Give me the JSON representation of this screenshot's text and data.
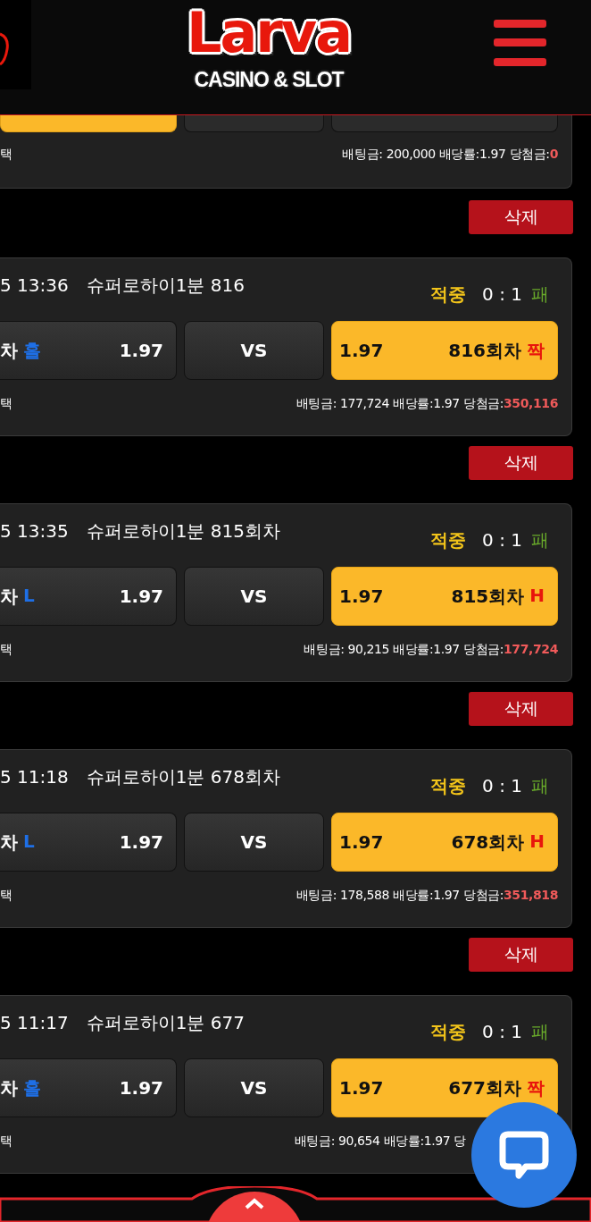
{
  "header": {
    "logo": {
      "title": "Larva",
      "subtitle": "CASINO & SLOT"
    }
  },
  "top_card": {
    "buttons": [
      {
        "selected": true
      },
      {
        "selected": false
      },
      {
        "selected": false
      }
    ],
    "choice": "택",
    "bet": "배팅금: 200,000 배당률:1.97 당첨금:",
    "win": "0",
    "delete": "삭제"
  },
  "cards": [
    {
      "date": "5 13:36",
      "game": "슈퍼로하이1분 816",
      "result": "적중",
      "score": "0 : 1",
      "outcome": "패",
      "left": {
        "label": "차",
        "pick": "홀",
        "color": "#1e6fe6",
        "odds": "1.97",
        "selected": false
      },
      "vs": "VS",
      "right": {
        "odds": "1.97",
        "label": "816회차",
        "pick": "짝",
        "color": "#e8150c",
        "selected": true
      },
      "choice": "택",
      "bet": "배팅금: 177,724 배당률:1.97 당첨금:",
      "win": "350,116",
      "delete": "삭제"
    },
    {
      "date": "5 13:35",
      "game": "슈퍼로하이1분 815회차",
      "result": "적중",
      "score": "0 : 1",
      "outcome": "패",
      "left": {
        "label": "차",
        "pick": "L",
        "color": "#1e6fe6",
        "odds": "1.97",
        "selected": false
      },
      "vs": "VS",
      "right": {
        "odds": "1.97",
        "label": "815회차",
        "pick": "H",
        "color": "#e8150c",
        "selected": true
      },
      "choice": "택",
      "bet": "배팅금: 90,215 배당률:1.97 당첨금:",
      "win": "177,724",
      "delete": "삭제"
    },
    {
      "date": "5 11:18",
      "game": "슈퍼로하이1분 678회차",
      "result": "적중",
      "score": "0 : 1",
      "outcome": "패",
      "left": {
        "label": "차",
        "pick": "L",
        "color": "#1e6fe6",
        "odds": "1.97",
        "selected": false
      },
      "vs": "VS",
      "right": {
        "odds": "1.97",
        "label": "678회차",
        "pick": "H",
        "color": "#e8150c",
        "selected": true
      },
      "choice": "택",
      "bet": "배팅금: 178,588 배당률:1.97 당첨금:",
      "win": "351,818",
      "delete": "삭제"
    },
    {
      "date": "5 11:17",
      "game": "슈퍼로하이1분 677",
      "result": "적중",
      "score": "0 : 1",
      "outcome": "패",
      "left": {
        "label": "차",
        "pick": "홀",
        "color": "#1e6fe6",
        "odds": "1.97",
        "selected": false
      },
      "vs": "VS",
      "right": {
        "odds": "1.97",
        "label": "677회차",
        "pick": "짝",
        "color": "#e8150c",
        "selected": true
      },
      "choice": "택",
      "bet": "배팅금: 90,654 배당률:1.97 당"
    }
  ]
}
